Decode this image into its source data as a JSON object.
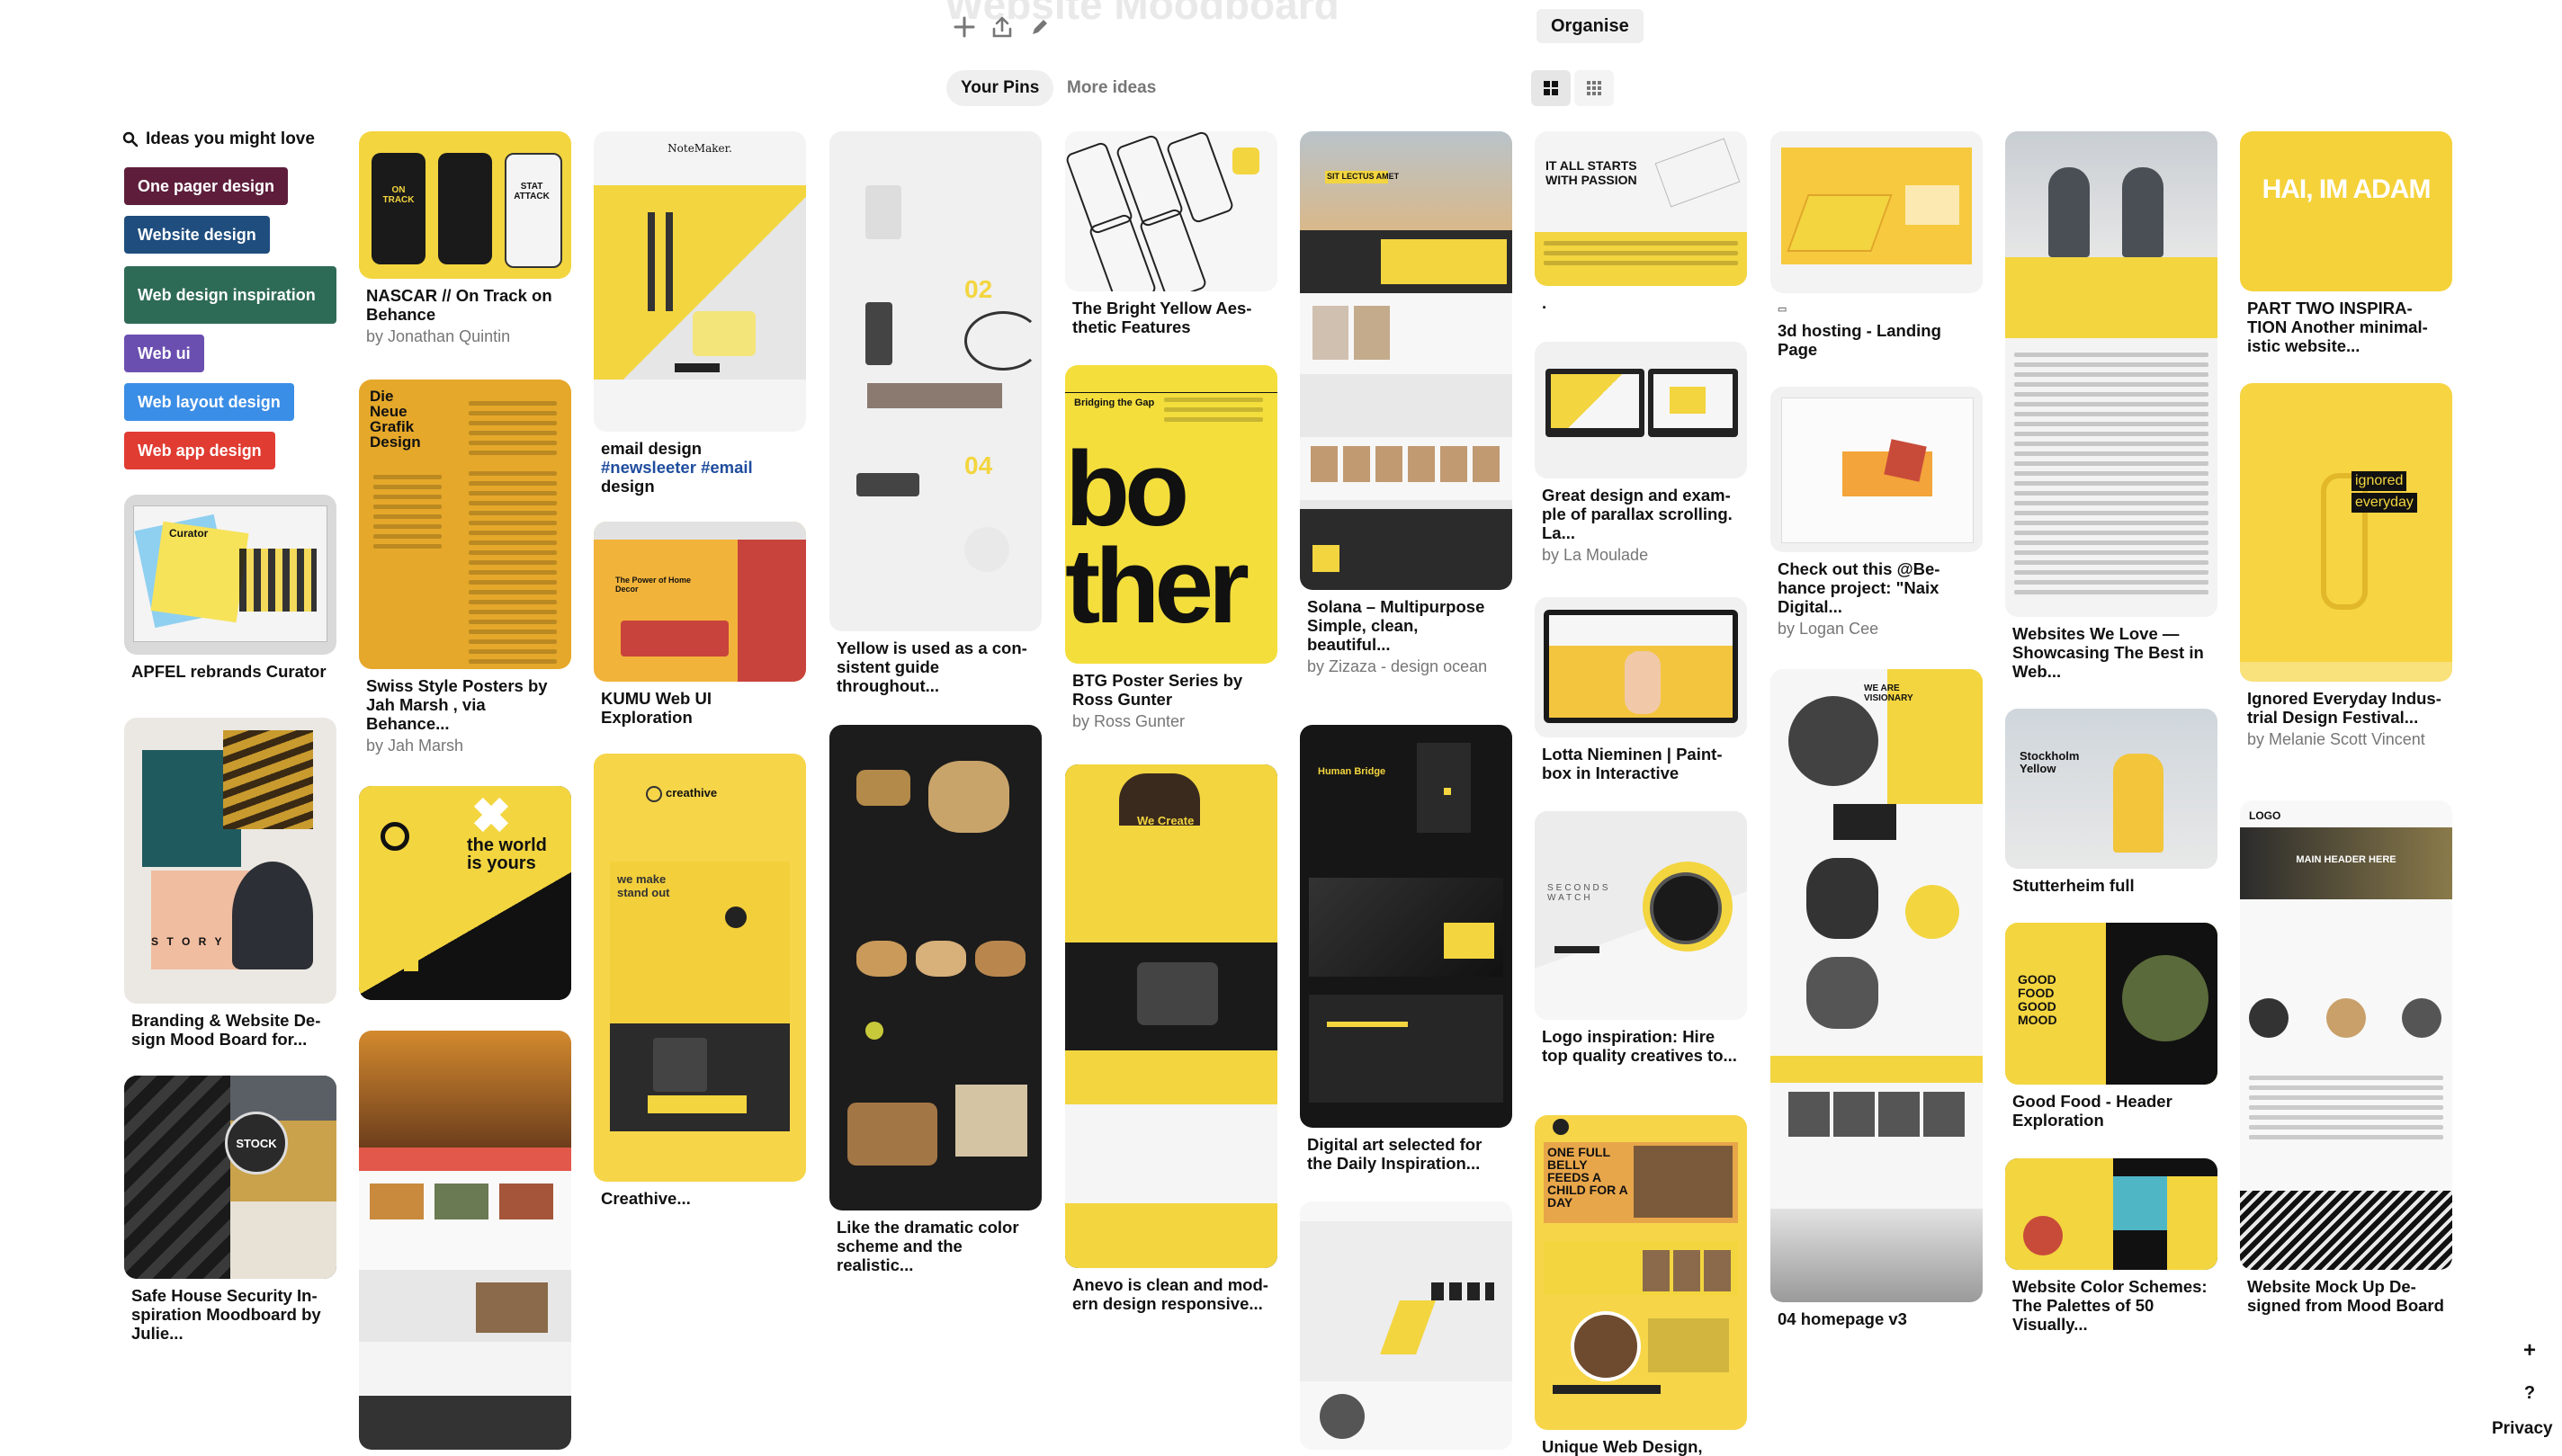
{
  "board": {
    "title": "Website Moodboard",
    "organise_label": "Organise",
    "tabs": [
      {
        "label": "Your Pins",
        "active": true
      },
      {
        "label": "More ideas",
        "active": false
      }
    ]
  },
  "ideas": {
    "title": "Ideas you might love",
    "chips": [
      {
        "label": "One pager design",
        "color": "#5e1e3b"
      },
      {
        "label": "Website design",
        "color": "#1f4d7e"
      },
      {
        "label": "Web design inspiration",
        "color": "#2e6b56"
      },
      {
        "label": "Web ui",
        "color": "#6b4fb0"
      },
      {
        "label": "Web layout design",
        "color": "#3b8ee6"
      },
      {
        "label": "Web app design",
        "color": "#e03c32"
      }
    ]
  },
  "pins": [
    {
      "caption": "APFEL rebrands Curator",
      "sub": ""
    },
    {
      "caption": "Branding & Website De­sign Mood Board for...",
      "sub": ""
    },
    {
      "caption": "Safe House Security In­spiration Moodboard by Julie...",
      "sub": ""
    },
    {
      "caption": "NASCAR // On Track on Behance",
      "sub": "by Jonathan Quintin"
    },
    {
      "caption": "Swiss Style Posters by Jah Marsh , via Behance...",
      "sub": "by Jah Marsh"
    },
    {
      "caption": "",
      "sub": ""
    },
    {
      "caption": "",
      "sub": ""
    },
    {
      "caption": "email design",
      "caption2": "#newsleeter #email",
      "caption3": "design",
      "sub": ""
    },
    {
      "caption": "KUMU Web UI Exploration",
      "sub": ""
    },
    {
      "caption": "Creathive...",
      "sub": ""
    },
    {
      "caption": "Yellow is used as a con­sistent guide throughout...",
      "sub": ""
    },
    {
      "caption": "Like the dramatic color scheme and the realistic...",
      "sub": ""
    },
    {
      "caption": "The Bright Yellow Aes­thetic Features",
      "sub": ""
    },
    {
      "caption": "BTG Poster Series by Ross Gunter",
      "sub": "by Ross Gunter"
    },
    {
      "caption": "Anevo is clean and mod­ern design responsive...",
      "sub": ""
    },
    {
      "caption": "Solana – Multipurpose Simple, clean, beautiful...",
      "sub": "by Zizaza - design ocean"
    },
    {
      "caption": "Digital art selected for the Daily Inspiration...",
      "sub": ""
    },
    {
      "caption": "",
      "sub": ""
    },
    {
      "caption": ".",
      "sub": ""
    },
    {
      "caption": "Great design and exam­ple of parallax scrolling. La...",
      "sub": "by La Moulade"
    },
    {
      "caption": "Lotta Nieminen | Paint­box in Interactive",
      "sub": ""
    },
    {
      "caption": "Logo inspiration: Hire top quality creatives to...",
      "sub": ""
    },
    {
      "caption": "Unique Web Design,",
      "sub": ""
    },
    {
      "caption": "3d hosting - Landing Page",
      "sub": ""
    },
    {
      "caption": "Check out this @Be­hance project: \"Naix Digital...",
      "sub": "by Logan Cee"
    },
    {
      "caption": "04 homepage v3",
      "sub": ""
    },
    {
      "caption": "Websites We Love — Showcasing The Best in Web...",
      "sub": ""
    },
    {
      "caption": "Stutterheim full",
      "sub": ""
    },
    {
      "caption": "Good Food - Header Exploration",
      "sub": ""
    },
    {
      "caption": "Website Color Schemes: The Palettes of 50 Visually...",
      "sub": ""
    },
    {
      "caption": "PART TWO INSPIRA­TION Another minimal­istic website...",
      "sub": ""
    },
    {
      "caption": "Ignored Everyday Indus­trial Design Festival...",
      "sub": "by Melanie Scott Vincent"
    },
    {
      "caption": "Website Mock Up De­signed from Mood Board",
      "sub": ""
    }
  ],
  "image_text": {
    "curator": "Curator",
    "nascar_1": "ON TRACK",
    "nascar_2": "STAT ATTACK",
    "neue_grafik": "Die Neue Grafik Design",
    "world": "the world is yours",
    "notemaker": "NoteMaker.",
    "kumu": "The Power of Home Decor",
    "creathive": "creathive",
    "standout": "we make stand out",
    "bother_1": "bo",
    "bother_2": "ther",
    "bridging": "Bridging the Gap",
    "create_business": "We Create Your Business",
    "sit_lectus": "SIT LECTUS AMET",
    "human_bridge": "Human Bridge",
    "passion": "IT ALL STARTS WITH PASSION",
    "seconds_watch": "SECONDS WATCH",
    "feeds": "ONE FULL BELLY FEEDS A CHILD FOR A DAY",
    "visionary": "WE ARE VISIONARY",
    "stockholm": "Stockholm Yellow",
    "good_food": "GOOD FOOD GOOD MOOD",
    "hai_adam": "HAI, IM ADAM",
    "ignored": "ignored",
    "everyday": "everyday",
    "logo": "LOGO",
    "main_header": "MAIN HEADER HERE",
    "stock": "STOCK"
  },
  "footer": {
    "plus": "+",
    "help": "?",
    "privacy": "Privacy"
  },
  "colors": {
    "yellow": "#f3d53f",
    "dark": "#1c1c1c",
    "muted": "#767676"
  }
}
